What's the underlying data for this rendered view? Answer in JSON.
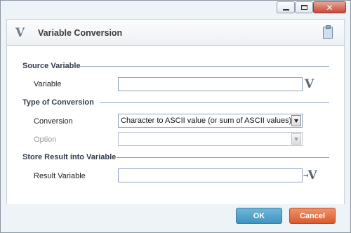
{
  "window": {
    "minimize_icon": "minimize-icon",
    "maximize_icon": "maximize-icon",
    "close_glyph": "✕"
  },
  "header": {
    "logo": "V",
    "title": "Variable Conversion",
    "clipboard_icon": "clipboard-icon"
  },
  "sections": {
    "source": {
      "title": "Source Variable",
      "variable_label": "Variable",
      "variable_value": "",
      "variable_button": "V"
    },
    "conversion": {
      "title": "Type of Conversion",
      "conversion_label": "Conversion",
      "conversion_value": "Character to ASCII value (or sum of ASCII values)",
      "option_label": "Option",
      "option_value": ""
    },
    "result": {
      "title": "Store Result into Variable",
      "result_label": "Result Variable",
      "result_value": "",
      "result_button": "V",
      "result_button_arrow": "→"
    }
  },
  "buttons": {
    "ok": "OK",
    "cancel": "Cancel"
  },
  "colors": {
    "ok": "#4a9fcb",
    "cancel": "#e06a3a",
    "section_line": "#8fa3bb"
  }
}
